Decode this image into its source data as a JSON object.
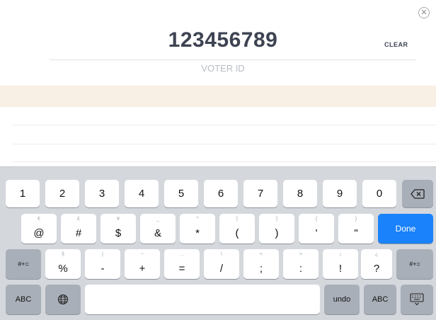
{
  "header": {
    "close_glyph": "✕",
    "voter_id_value": "123456789",
    "clear_label": "CLEAR",
    "field_label": "VOTER ID"
  },
  "colors": {
    "highlight_band": "#f8efe5",
    "done_key": "#1a82fb",
    "keyboard_bg": "#d4d7dc"
  },
  "keyboard": {
    "row1": [
      "1",
      "2",
      "3",
      "4",
      "5",
      "6",
      "7",
      "8",
      "9",
      "0"
    ],
    "row2": [
      {
        "main": "@",
        "alt": "€"
      },
      {
        "main": "#",
        "alt": "£"
      },
      {
        "main": "$",
        "alt": "¥"
      },
      {
        "main": "&",
        "alt": "_"
      },
      {
        "main": "*",
        "alt": "^"
      },
      {
        "main": "(",
        "alt": "["
      },
      {
        "main": ")",
        "alt": "]"
      },
      {
        "main": "'",
        "alt": "{"
      },
      {
        "main": "\"",
        "alt": "}"
      }
    ],
    "done_label": "Done",
    "shift_label": "#+=",
    "row3": [
      {
        "main": "%",
        "alt": "§"
      },
      {
        "main": "-",
        "alt": "|"
      },
      {
        "main": "+",
        "alt": "~"
      },
      {
        "main": "=",
        "alt": "…"
      },
      {
        "main": "/",
        "alt": "\\"
      },
      {
        "main": ";",
        "alt": "<"
      },
      {
        "main": ":",
        "alt": ">"
      },
      {
        "main": "!",
        "alt": "¡"
      },
      {
        "main": "?",
        "alt": "¿"
      }
    ],
    "shift_label_right": "#+=",
    "abc_label_left": "ABC",
    "undo_label": "undo",
    "abc_label_right": "ABC",
    "icons": {
      "backspace": "backspace-icon",
      "globe": "globe-icon",
      "dismiss_keyboard": "keyboard-dismiss-icon"
    }
  }
}
